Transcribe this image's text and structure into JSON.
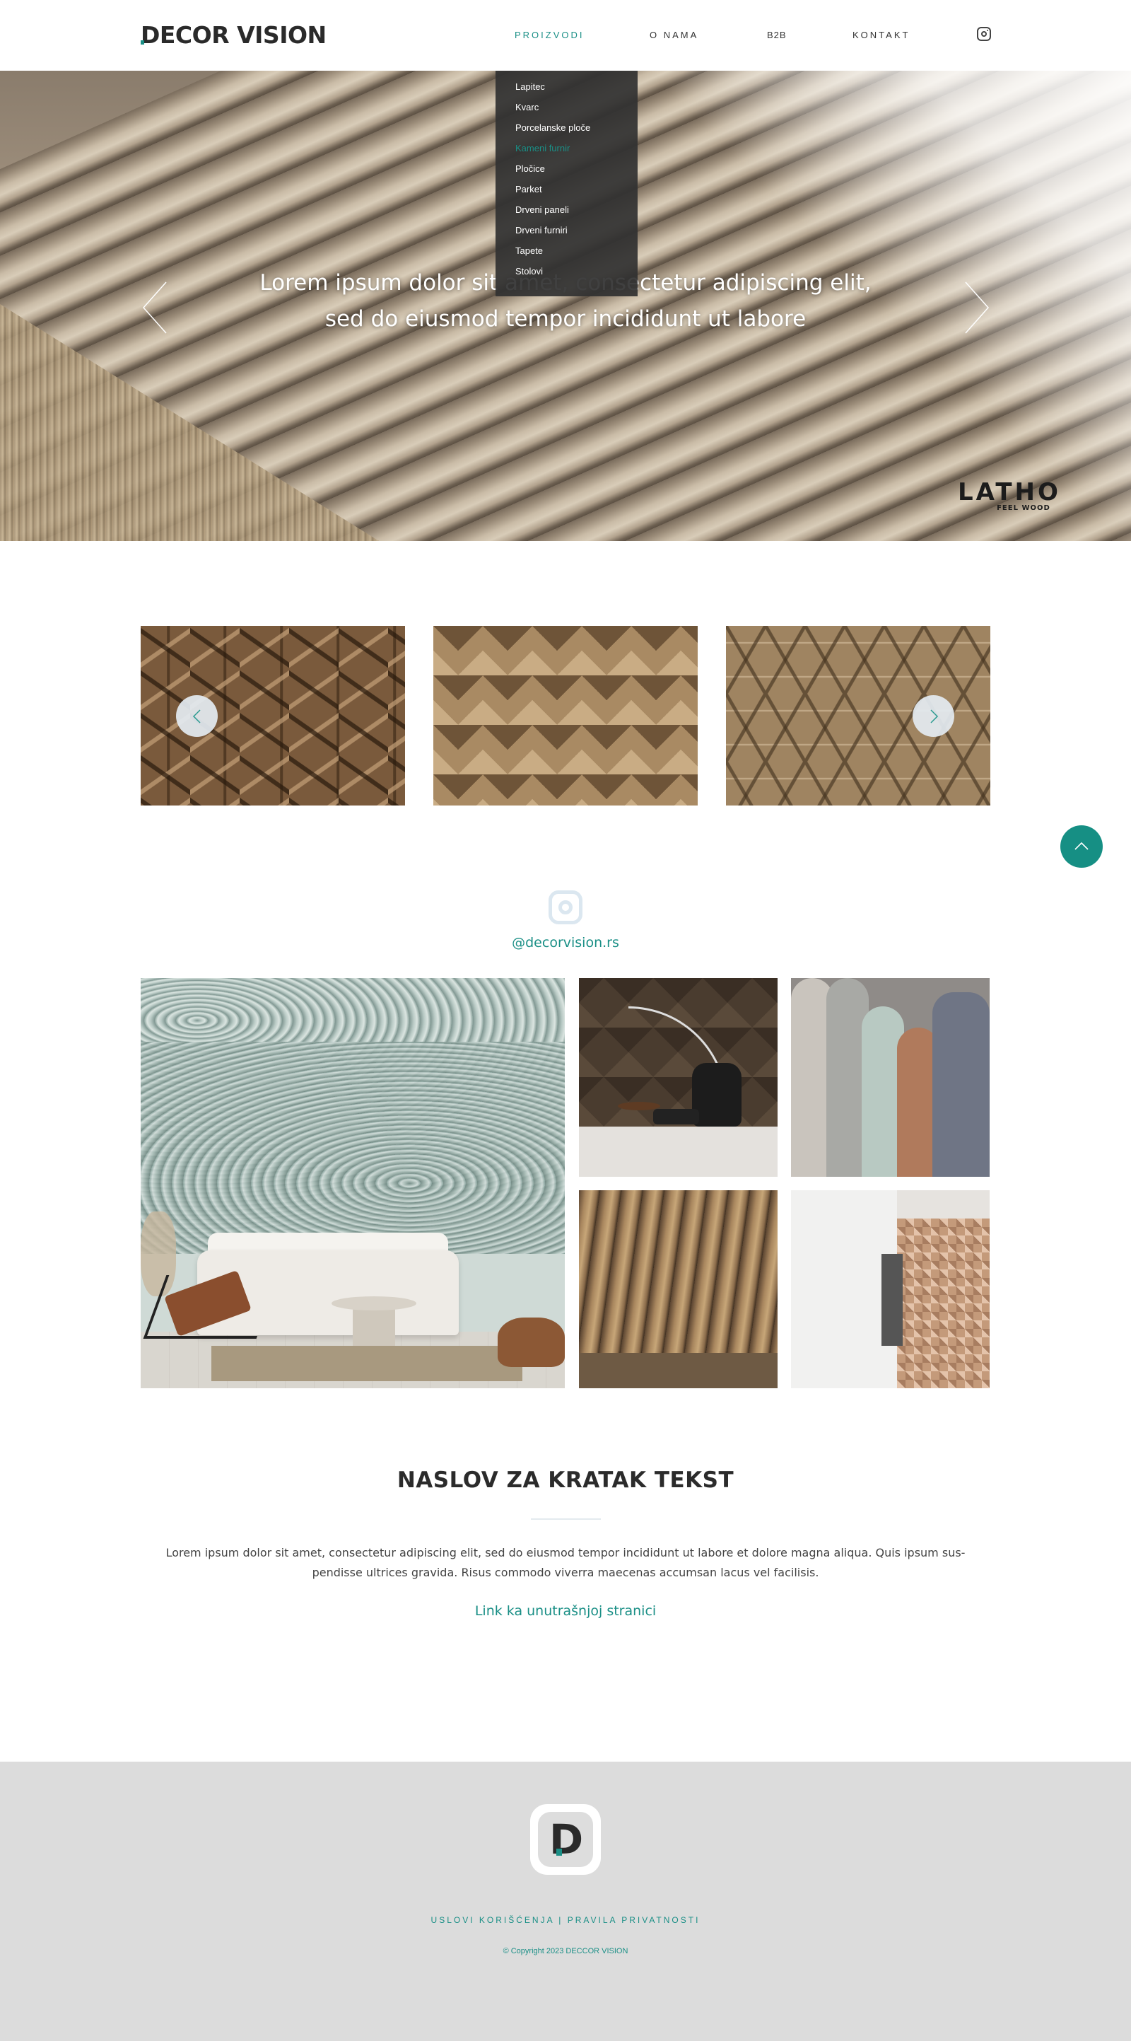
{
  "header": {
    "logo": "DECOR VISION",
    "nav": [
      {
        "label": "PROIZVODI",
        "active": true
      },
      {
        "label": "O NAMA",
        "active": false
      },
      {
        "label": "B2B",
        "active": false
      },
      {
        "label": "KONTAKT",
        "active": false
      }
    ],
    "social_icon": "instagram-icon"
  },
  "dropdown": {
    "items": [
      {
        "label": "Lapitec",
        "active": false
      },
      {
        "label": "Kvarc",
        "active": false
      },
      {
        "label": "Porcelanske ploče",
        "active": false
      },
      {
        "label": "Kameni furnir",
        "active": true
      },
      {
        "label": "Pločice",
        "active": false
      },
      {
        "label": "Parket",
        "active": false
      },
      {
        "label": "Drveni paneli",
        "active": false
      },
      {
        "label": "Drveni furniri",
        "active": false
      },
      {
        "label": "Tapete",
        "active": false
      },
      {
        "label": "Stolovi",
        "active": false
      }
    ]
  },
  "hero": {
    "text_line1": "Lorem ipsum dolor sit amet, consectetur adipiscing elit,",
    "text_line2": "sed do eiusmod tempor incididunt ut labore",
    "brand": "LATHO",
    "brand_tagline": "FEEL WOOD",
    "prev_icon": "chevron-left-icon",
    "next_icon": "chevron-right-icon"
  },
  "carousel": {
    "prev_icon": "chevron-left-icon",
    "next_icon": "chevron-right-icon"
  },
  "instagram": {
    "icon": "instagram-icon",
    "handle": "@decorvision.rs"
  },
  "text_section": {
    "title": "NASLOV ZA KRATAK TEKST",
    "body": "Lorem ipsum dolor sit amet, consectetur adipiscing elit, sed do eiusmod tempor incididunt ut labore et dolore magna aliqua. Quis ipsum sus-pendisse ultrices gravida. Risus commodo viverra maecenas accumsan lacus vel facilisis.",
    "link": "Link ka unutrašnjoj stranici"
  },
  "footer": {
    "logo_letter": "D",
    "link_terms": "USLOVI KORIŠĆENJA",
    "separator": "|",
    "link_privacy": "PRAVILA PRIVATNOSTI",
    "copyright": "© Copyright 2023 DECCOR VISION"
  },
  "colors": {
    "accent": "#1a8f86",
    "footer_bg": "#dcdcdc",
    "dropdown_bg": "#323232"
  }
}
